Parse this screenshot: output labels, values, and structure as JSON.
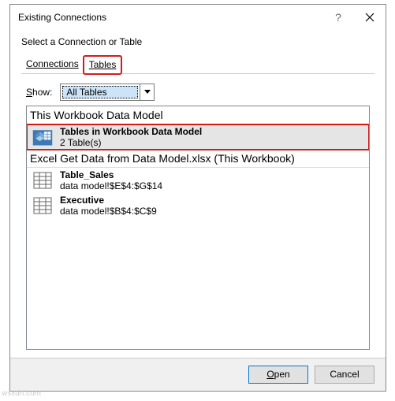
{
  "title": "Existing Connections",
  "instruction": "Select a Connection or Table",
  "tabs": {
    "connections": "Connections",
    "tables": "Tables"
  },
  "show": {
    "label": "Show:",
    "selected": "All Tables"
  },
  "groups": [
    {
      "header": "This Workbook Data Model",
      "items": [
        {
          "title": "Tables in Workbook Data Model",
          "subtitle": "2 Table(s)",
          "icon": "cube",
          "selected": true
        }
      ]
    },
    {
      "header": "Excel Get Data from Data Model.xlsx (This Workbook)",
      "items": [
        {
          "title": "Table_Sales",
          "subtitle": "data model!$E$4:$G$14",
          "icon": "table",
          "selected": false
        },
        {
          "title": "Executive",
          "subtitle": "data model!$B$4:$C$9",
          "icon": "table",
          "selected": false
        }
      ]
    }
  ],
  "buttons": {
    "open": "Open",
    "cancel": "Cancel"
  },
  "watermark": "wsxdn.com"
}
